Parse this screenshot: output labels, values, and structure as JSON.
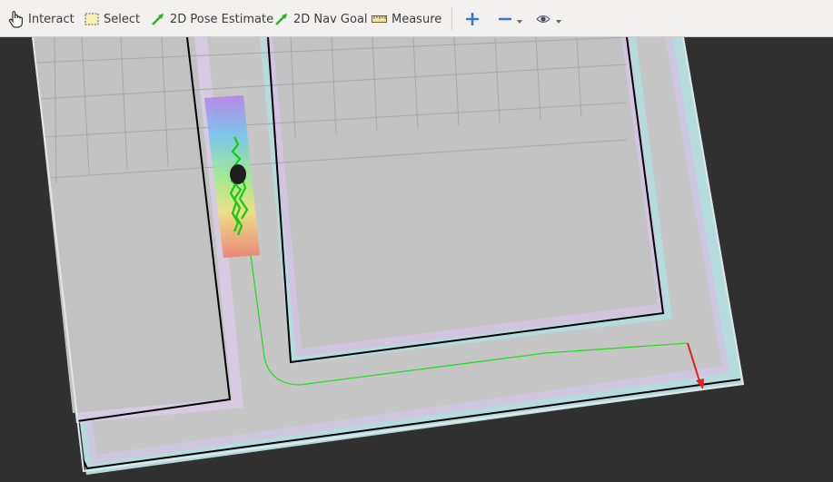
{
  "toolbar": {
    "interact": "Interact",
    "select": "Select",
    "pose_estimate": "2D Pose Estimate",
    "nav_goal": "2D Nav Goal",
    "measure": "Measure",
    "zoom_in_icon": "plus-icon",
    "zoom_out_icon": "minus-icon",
    "camera_icon": "eye-icon"
  },
  "colors": {
    "background": "#303030",
    "free_space": "#c2c2c2",
    "inflation_cyan": "#b4dcdc",
    "inflation_pink": "#d9bde0",
    "wall": "#000000",
    "global_plan": "#22dd22",
    "goal_arrow": "#dd2222",
    "grid": "#a8a8a8",
    "particle_cloud": "#11cc11",
    "robot": "#1e1e1e"
  }
}
